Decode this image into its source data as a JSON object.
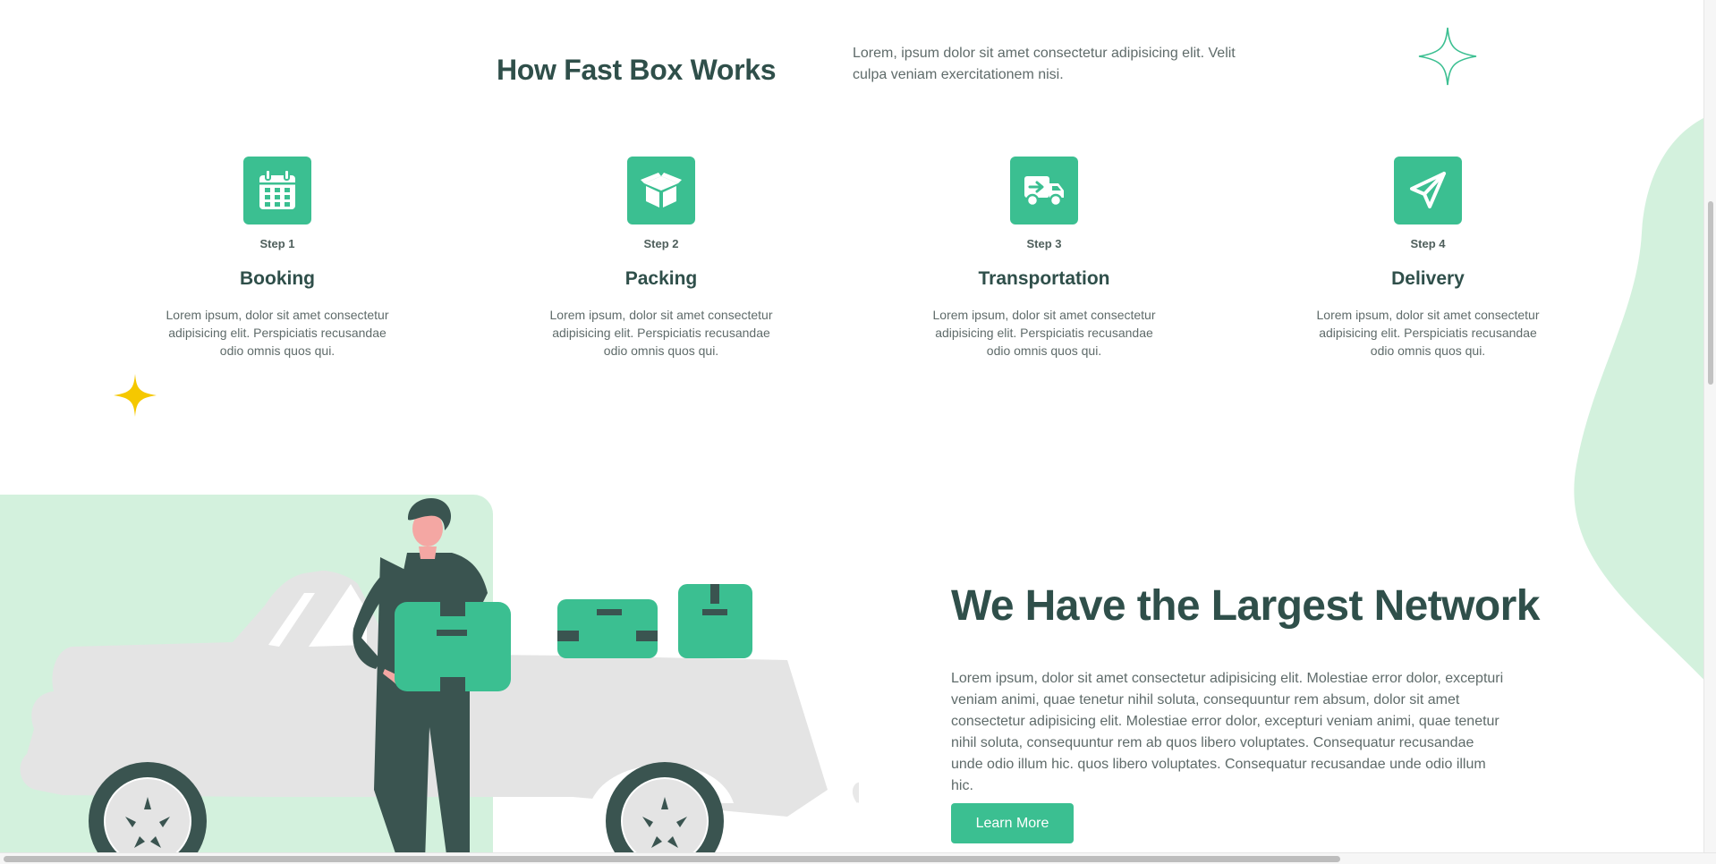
{
  "header": {
    "title": "How Fast Box Works",
    "intro": "Lorem, ipsum dolor sit amet consectetur adipisicing elit. Velit culpa veniam exercitationem nisi."
  },
  "steps": [
    {
      "step": "Step 1",
      "title": "Booking",
      "text": "Lorem ipsum, dolor sit amet consectetur adipisicing elit. Perspiciatis recusandae odio omnis quos qui.",
      "icon": "calendar-icon"
    },
    {
      "step": "Step 2",
      "title": "Packing",
      "text": "Lorem ipsum, dolor sit amet consectetur adipisicing elit. Perspiciatis recusandae odio omnis quos qui.",
      "icon": "open-box-icon"
    },
    {
      "step": "Step 3",
      "title": "Transportation",
      "text": "Lorem ipsum, dolor sit amet consectetur adipisicing elit. Perspiciatis recusandae odio omnis quos qui.",
      "icon": "truck-icon"
    },
    {
      "step": "Step 4",
      "title": "Delivery",
      "text": "Lorem ipsum, dolor sit amet consectetur adipisicing elit. Perspiciatis recusandae odio omnis quos qui.",
      "icon": "paper-plane-icon"
    }
  ],
  "network": {
    "title": "We Have the Largest Network",
    "text": "Lorem ipsum, dolor sit amet consectetur adipisicing elit. Molestiae error dolor, excepturi veniam animi, quae tenetur nihil soluta, consequuntur rem absum, dolor sit amet consectetur adipisicing elit. Molestiae error dolor, excepturi veniam animi, quae tenetur nihil soluta, consequuntur rem ab quos libero voluptates. Consequatur recusandae unde odio illum hic. quos libero voluptates. Consequatur recusandae unde odio illum hic.",
    "button": "Learn More"
  },
  "colors": {
    "accent": "#3bbf91",
    "heading": "#2f4f4a",
    "panel": "#d3f1dd",
    "sparkle": "#f5c800"
  }
}
